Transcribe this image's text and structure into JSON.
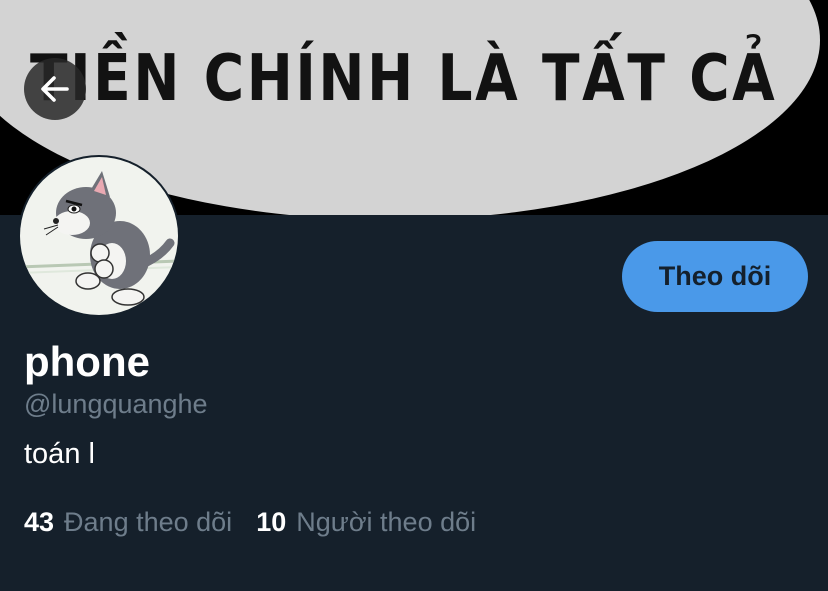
{
  "banner": {
    "text": "TIỀN CHÍNH LÀ TẤT CẢ"
  },
  "back_button": {
    "icon": "arrow-left-icon"
  },
  "profile": {
    "display_name": "phone",
    "handle": "@lungquanghe",
    "bio": "toán l"
  },
  "follow_button": {
    "label": "Theo dõi",
    "color": "#4a99e9"
  },
  "stats": {
    "following": {
      "count": "43",
      "label": "Đang theo dõi"
    },
    "followers": {
      "count": "10",
      "label": "Người theo dõi"
    }
  }
}
